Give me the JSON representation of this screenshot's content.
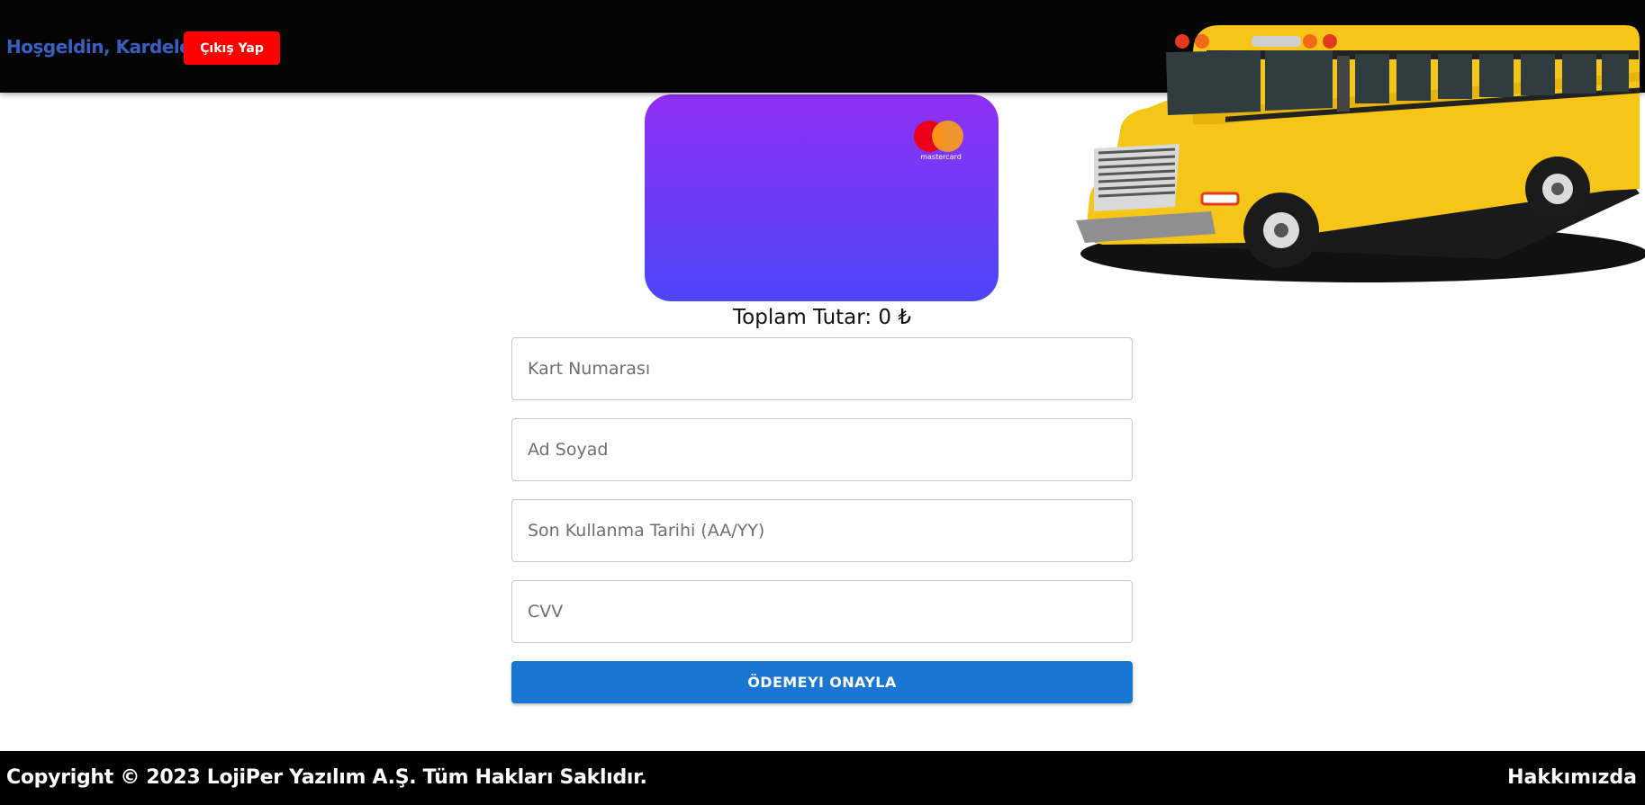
{
  "header": {
    "welcome_text": "Hoşgeldin, Kardelen",
    "logout_label": "Çıkış Yap"
  },
  "card": {
    "brand_label": "mastercard"
  },
  "payment": {
    "total_label": "Toplam Tutar: 0 ₺",
    "card_number_placeholder": "Kart Numarası",
    "name_placeholder": "Ad Soyad",
    "expiry_placeholder": "Son Kullanma Tarihi (AA/YY)",
    "cvv_placeholder": "CVV",
    "confirm_label": "ÖDEMEYI ONAYLA"
  },
  "footer": {
    "copyright": "Copyright © 2023 LojiPer Yazılım A.Ş. Tüm Hakları Saklıdır.",
    "about_label": "Hakkımızda"
  },
  "colors": {
    "topbar": "#050505",
    "welcome_text": "#3b5fc0",
    "logout_button": "#ff0000",
    "confirm_button": "#1976d2",
    "card_gradient_top": "#8f30f6",
    "card_gradient_bottom": "#4b46f8",
    "bus_body": "#f5c518"
  },
  "icons": {
    "card_brand": "mastercard-logo",
    "banner": "school-bus-illustration"
  }
}
